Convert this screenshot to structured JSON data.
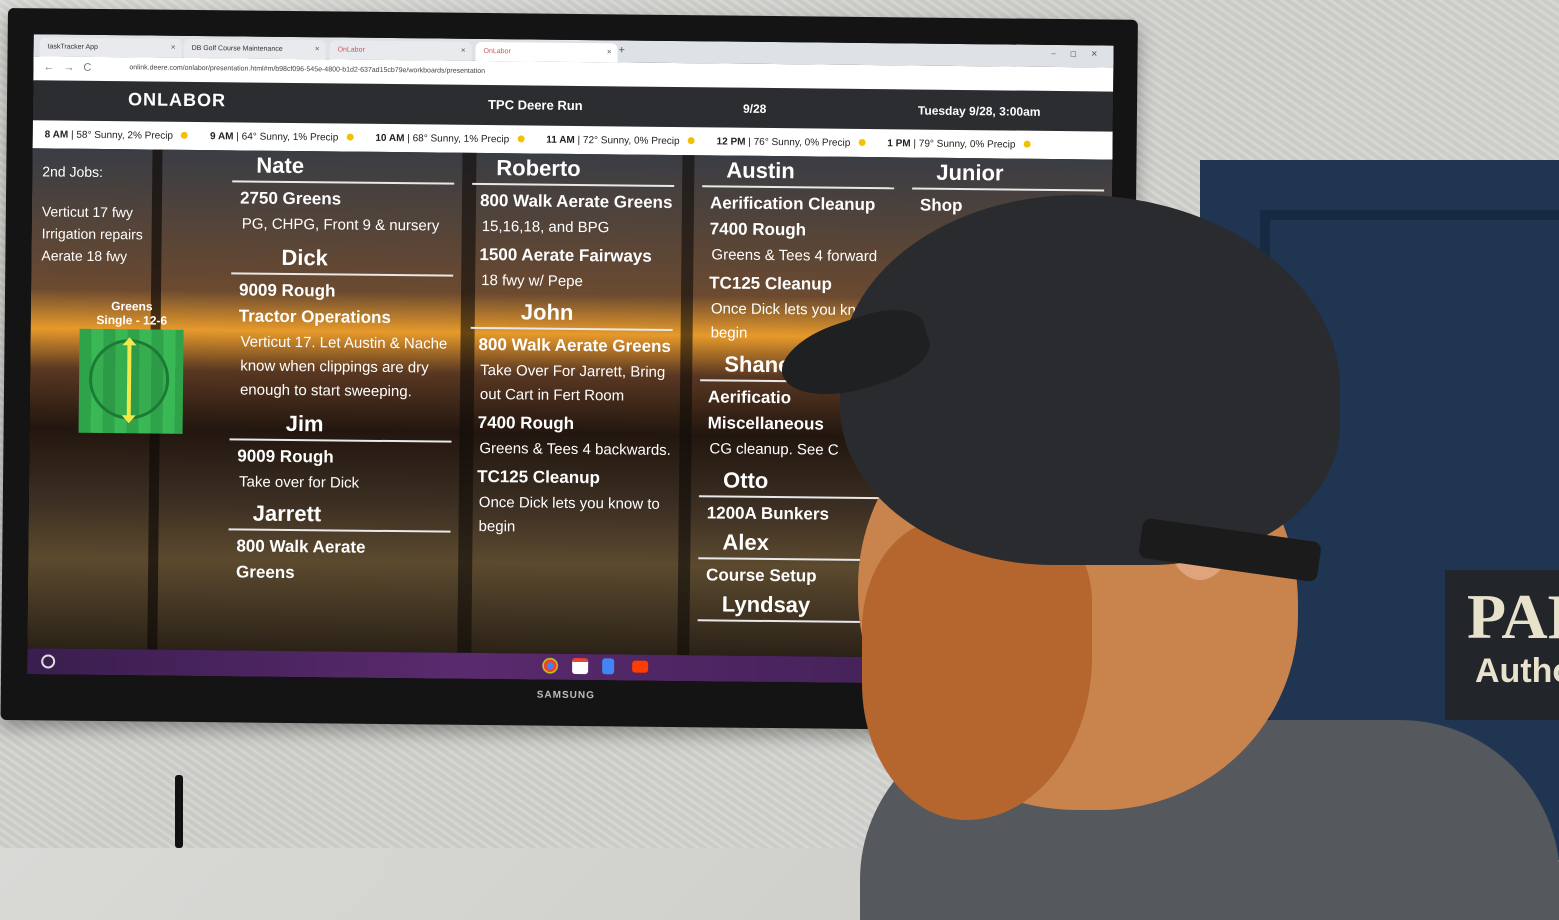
{
  "browser": {
    "tabs": [
      {
        "label": "taskTracker App"
      },
      {
        "label": "DB Golf Course Maintenance"
      },
      {
        "label": "OnLabor"
      },
      {
        "label": "OnLabor"
      }
    ],
    "new_tab": "+",
    "url": "onlink.deere.com/onlabor/presentation.html#m/b98cf096-545e-4800-b1d2-637ad15cb79e/workboards/presentation",
    "nav_back": "←",
    "nav_forward": "→",
    "nav_reload": "C"
  },
  "header": {
    "logo": "ONLABOR",
    "course": "TPC Deere Run",
    "date": "9/28",
    "datetime": "Tuesday 9/28, 3:00am"
  },
  "weather": [
    {
      "time": "8 AM",
      "desc": "| 58° Sunny, 2% Precip"
    },
    {
      "time": "9 AM",
      "desc": "| 64° Sunny, 1% Precip"
    },
    {
      "time": "10 AM",
      "desc": "| 68° Sunny, 1% Precip"
    },
    {
      "time": "11 AM",
      "desc": "| 72° Sunny, 0% Precip"
    },
    {
      "time": "12 PM",
      "desc": "| 76° Sunny, 0% Precip"
    },
    {
      "time": "1 PM",
      "desc": "| 79° Sunny, 0% Precip"
    }
  ],
  "sidebar": {
    "heading": "2nd Jobs:",
    "items": [
      "Verticut 17 fwy",
      "Irrigation repairs",
      "Aerate 18 fwy"
    ],
    "greens_label": "Greens",
    "greens_sub": "Single - 12-6"
  },
  "workers": {
    "nate": {
      "name": "Nate",
      "t1": "2750 Greens",
      "n1": "PG, CHPG, Front 9 & nursery"
    },
    "dick": {
      "name": "Dick",
      "t1": "9009 Rough",
      "t2": "Tractor Operations",
      "n2": "Verticut 17. Let Austin & Nache know when clippings are dry enough to start sweeping."
    },
    "jim": {
      "name": "Jim",
      "t1": "9009 Rough",
      "n1": "Take over for Dick"
    },
    "jarrett": {
      "name": "Jarrett",
      "t1": "800 Walk Aerate",
      "t2": "Greens"
    },
    "roberto": {
      "name": "Roberto",
      "t1": "800 Walk Aerate Greens",
      "n1": "15,16,18, and BPG",
      "t2": "1500 Aerate Fairways",
      "n2": "18 fwy w/ Pepe"
    },
    "john": {
      "name": "John",
      "t1": "800 Walk Aerate Greens",
      "n1": "Take Over For Jarrett, Bring out Cart in Fert Room",
      "t2": "7400 Rough",
      "n2": "Greens & Tees 4 backwards.",
      "t3": "TC125 Cleanup",
      "n3": "Once Dick lets you know to begin"
    },
    "austin": {
      "name": "Austin",
      "t1": "Aerification Cleanup",
      "t2": "7400 Rough",
      "n2": "Greens & Tees 4 forward",
      "t3": "TC125 Cleanup",
      "n3": "Once Dick lets you know to begin"
    },
    "shane": {
      "name": "Shane",
      "t1": "Aerificatio",
      "t2": "Miscellaneous",
      "n2": "CG cleanup. See C"
    },
    "otto": {
      "name": "Otto",
      "t1": "1200A Bunkers"
    },
    "alex": {
      "name": "Alex",
      "t1": "Course Setup"
    },
    "lyndsay": {
      "name": "Lyndsay"
    },
    "junior": {
      "name": "Junior",
      "t1": "Shop"
    }
  },
  "tv_brand": "SAMSUNG",
  "wall_sign": {
    "line1": "PAR",
    "line2": "Author"
  },
  "colors": {
    "header_bg": "#2b2d31",
    "sun": "#f2c200",
    "green": "#2fa34a",
    "taskbar": "#5a2a6e"
  },
  "icons": [
    "chrome-icon",
    "gmail-icon",
    "docs-icon",
    "youtube-icon"
  ]
}
